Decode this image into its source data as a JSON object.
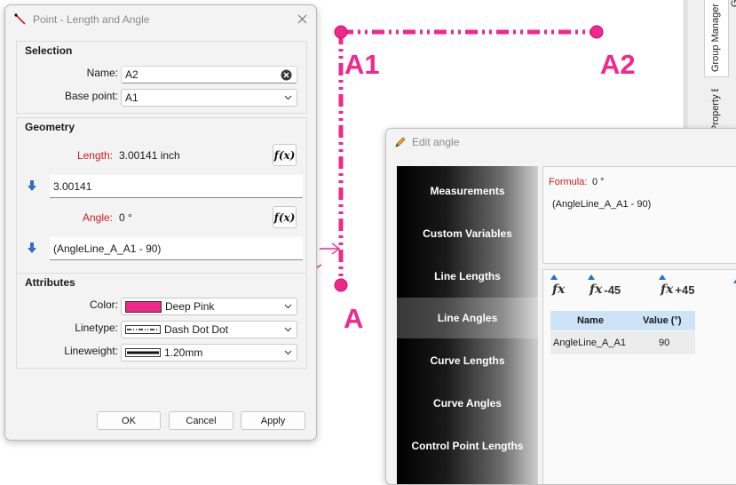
{
  "canvas": {
    "color": "#f0288c",
    "points": {
      "a1": "A1",
      "a2": "A2",
      "a": "A"
    }
  },
  "dock": {
    "tabs": [
      "Group Manager",
      "Property Editor",
      "G"
    ]
  },
  "point_dialog": {
    "title": "Point - Length and Angle",
    "selection": {
      "header": "Selection",
      "name_label": "Name:",
      "name_value": "A2",
      "base_label": "Base point:",
      "base_value": "A1"
    },
    "geometry": {
      "header": "Geometry",
      "length_label": "Length:",
      "length_value": "3.00141 inch",
      "length_formula": "3.00141",
      "angle_label": "Angle:",
      "angle_value": "0 °",
      "angle_formula": "(AngleLine_A_A1 - 90)",
      "fx_label": "f(x)"
    },
    "attributes": {
      "header": "Attributes",
      "color_label": "Color:",
      "color_value": "Deep Pink",
      "color_hex": "#f0288c",
      "linetype_label": "Linetype:",
      "linetype_value": "Dash Dot Dot",
      "lineweight_label": "Lineweight:",
      "lineweight_value": "1.20mm"
    },
    "buttons": {
      "ok": "OK",
      "cancel": "Cancel",
      "apply": "Apply"
    }
  },
  "edit_angle": {
    "title": "Edit angle",
    "sidebar": [
      "Measurements",
      "Custom Variables",
      "Line Lengths",
      "Line Angles",
      "Curve Lengths",
      "Curve Angles",
      "Control Point Lengths"
    ],
    "selected": "Line Angles",
    "formula_label": "Formula:",
    "formula_value": "0 °",
    "formula_text": "(AngleLine_A_A1 - 90)",
    "toolbar": {
      "fx": "fx",
      "minus45": "-45",
      "plus45": "+45"
    },
    "table": {
      "headers": [
        "Name",
        "Value (°)"
      ],
      "rows": [
        [
          "AngleLine_A_A1",
          "90"
        ]
      ]
    }
  }
}
